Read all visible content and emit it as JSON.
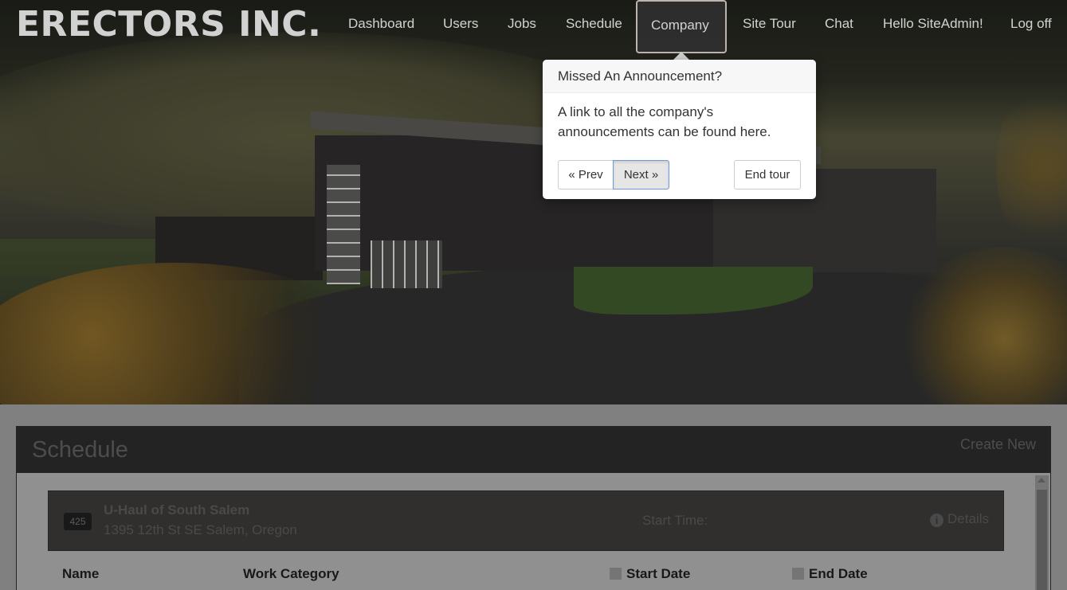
{
  "brand": {
    "logo_text": "ERECTORS INC."
  },
  "nav": {
    "items": [
      {
        "label": "Dashboard"
      },
      {
        "label": "Users"
      },
      {
        "label": "Jobs"
      },
      {
        "label": "Schedule"
      },
      {
        "label": "Company",
        "active": true
      },
      {
        "label": "Site Tour"
      },
      {
        "label": "Chat"
      },
      {
        "label": "Hello SiteAdmin!"
      },
      {
        "label": "Log off"
      }
    ]
  },
  "tour": {
    "title": "Missed An Announcement?",
    "content": "A link to all the company's announcements can be found here.",
    "prev_label": "« Prev",
    "next_label": "Next »",
    "end_label": "End tour"
  },
  "schedule": {
    "title": "Schedule",
    "create_new": "Create New",
    "job": {
      "number": "425",
      "name": "U-Haul of South Salem",
      "address": "1395 12th St SE Salem, Oregon",
      "start_time_label": "Start Time:",
      "details_label": "Details"
    },
    "columns": [
      "Name",
      "Work Category",
      "Start Date",
      "End Date"
    ]
  },
  "colors": {
    "accent_border": "#e6dcd6",
    "next_focus": "#6a9bd8"
  },
  "icons": {
    "info": "info-circle-icon",
    "scroll_up": "chevron-up-icon"
  }
}
